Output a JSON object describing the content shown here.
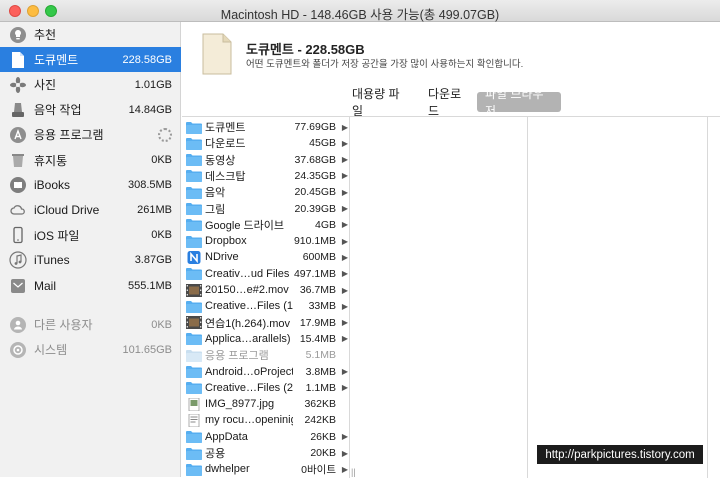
{
  "window": {
    "title": "Macintosh HD - 148.46GB 사용 가능(총 499.07GB)"
  },
  "sidebar": {
    "items": [
      {
        "label": "추천",
        "size": "",
        "icon": "lightbulb-icon",
        "state": "normal"
      },
      {
        "label": "도큐멘트",
        "size": "228.58GB",
        "icon": "document-icon",
        "state": "selected"
      },
      {
        "label": "사진",
        "size": "1.01GB",
        "icon": "photos-icon",
        "state": "normal"
      },
      {
        "label": "음악 작업",
        "size": "14.84GB",
        "icon": "music-creation-icon",
        "state": "normal"
      },
      {
        "label": "응용 프로그램",
        "size": "",
        "icon": "app-store-icon",
        "state": "loading"
      },
      {
        "label": "휴지통",
        "size": "0KB",
        "icon": "trash-icon",
        "state": "normal"
      },
      {
        "label": "iBooks",
        "size": "308.5MB",
        "icon": "book-icon",
        "state": "normal"
      },
      {
        "label": "iCloud Drive",
        "size": "261MB",
        "icon": "cloud-icon",
        "state": "normal"
      },
      {
        "label": "iOS 파일",
        "size": "0KB",
        "icon": "phone-icon",
        "state": "normal"
      },
      {
        "label": "iTunes",
        "size": "3.87GB",
        "icon": "music-note-icon",
        "state": "normal"
      },
      {
        "label": "Mail",
        "size": "555.1MB",
        "icon": "mail-icon",
        "state": "normal"
      },
      {
        "label": "다른 사용자",
        "size": "0KB",
        "icon": "users-icon",
        "state": "dim"
      },
      {
        "label": "시스템",
        "size": "101.65GB",
        "icon": "system-icon",
        "state": "dim"
      }
    ]
  },
  "header": {
    "title": "도큐멘트 - 228.58GB",
    "description": "어떤 도큐멘트와 폴더가 저장 공간을 가장 많이 사용하는지 확인합니다."
  },
  "tabs": [
    {
      "label": "대용량 파일",
      "active": false
    },
    {
      "label": "다운로드",
      "active": false
    },
    {
      "label": "파일 브라우저",
      "active": true
    }
  ],
  "files": [
    {
      "name": "도큐멘트",
      "size": "77.69GB",
      "kind": "folder",
      "icon": "folder-icon",
      "arrow": true
    },
    {
      "name": "다운로드",
      "size": "45GB",
      "kind": "folder",
      "icon": "folder-icon",
      "arrow": true
    },
    {
      "name": "동영상",
      "size": "37.68GB",
      "kind": "folder",
      "icon": "folder-icon",
      "arrow": true
    },
    {
      "name": "데스크탑",
      "size": "24.35GB",
      "kind": "folder",
      "icon": "folder-icon",
      "arrow": true
    },
    {
      "name": "음악",
      "size": "20.45GB",
      "kind": "folder",
      "icon": "folder-icon",
      "arrow": true
    },
    {
      "name": "그림",
      "size": "20.39GB",
      "kind": "folder",
      "icon": "folder-icon",
      "arrow": true
    },
    {
      "name": "Google 드라이브",
      "size": "4GB",
      "kind": "folder",
      "icon": "folder-icon",
      "arrow": true
    },
    {
      "name": "Dropbox",
      "size": "910.1MB",
      "kind": "folder",
      "icon": "folder-icon",
      "arrow": true
    },
    {
      "name": "NDrive",
      "size": "600MB",
      "kind": "app",
      "icon": "ndrive-icon",
      "arrow": true
    },
    {
      "name": "Creativ…ud Files",
      "size": "497.1MB",
      "kind": "folder",
      "icon": "folder-icon",
      "arrow": true
    },
    {
      "name": "20150…e#2.mov",
      "size": "36.7MB",
      "kind": "video",
      "icon": "video-icon",
      "arrow": true
    },
    {
      "name": "Creative…Files (1)",
      "size": "33MB",
      "kind": "folder",
      "icon": "folder-icon",
      "arrow": true
    },
    {
      "name": "연습1(h.264).mov",
      "size": "17.9MB",
      "kind": "video",
      "icon": "video-icon",
      "arrow": true
    },
    {
      "name": "Applica…arallels)",
      "size": "15.4MB",
      "kind": "folder",
      "icon": "folder-icon",
      "arrow": true
    },
    {
      "name": "응용 프로그램",
      "size": "5.1MB",
      "kind": "folder-dim",
      "icon": "folder-icon",
      "arrow": false
    },
    {
      "name": "Android…oProjects",
      "size": "3.8MB",
      "kind": "folder",
      "icon": "folder-icon",
      "arrow": true
    },
    {
      "name": "Creative…Files (2)",
      "size": "1.1MB",
      "kind": "folder",
      "icon": "folder-icon",
      "arrow": true
    },
    {
      "name": "IMG_8977.jpg",
      "size": "362KB",
      "kind": "image",
      "icon": "image-file-icon",
      "arrow": false
    },
    {
      "name": "my rocu…openinig",
      "size": "242KB",
      "kind": "document",
      "icon": "document-file-icon",
      "arrow": false
    },
    {
      "name": "AppData",
      "size": "26KB",
      "kind": "folder",
      "icon": "folder-icon",
      "arrow": true
    },
    {
      "name": "공용",
      "size": "20KB",
      "kind": "folder",
      "icon": "folder-icon",
      "arrow": true
    },
    {
      "name": "dwhelper",
      "size": "0바이트",
      "kind": "folder",
      "icon": "folder-icon",
      "arrow": true
    }
  ],
  "watermark": "http://parkpictures.tistory.com",
  "colors": {
    "selection": "#2a7fe0",
    "folder": "#56aef0",
    "active_tab": "#b3b3b3"
  }
}
